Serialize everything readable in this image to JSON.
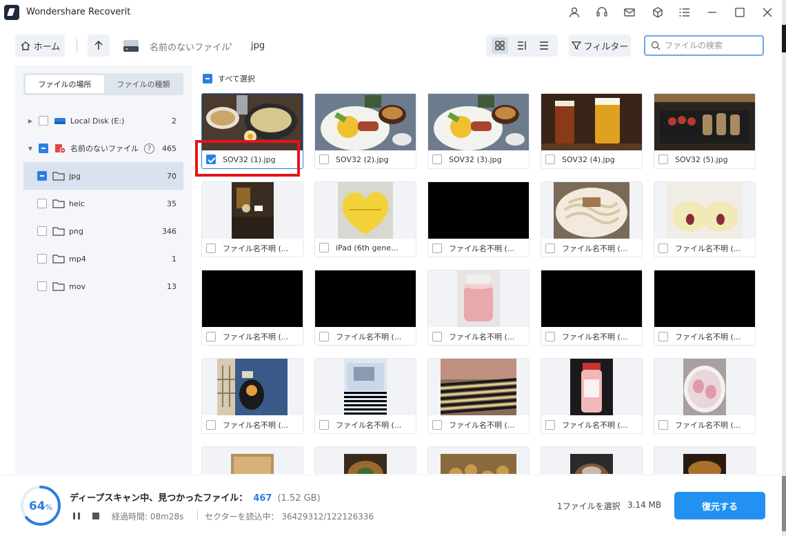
{
  "window": {
    "title": "Wondershare Recoverit"
  },
  "toolbar": {
    "home_label": "ホーム",
    "breadcrumb": [
      "名前のないファイル",
      "jpg"
    ],
    "filter_label": "フィルター",
    "search_placeholder": "ファイルの検索"
  },
  "sidebar": {
    "tabs": [
      "ファイルの場所",
      "ファイルの種類"
    ],
    "active_tab": 0,
    "tree": [
      {
        "label": "Local Disk (E:)",
        "count": "2",
        "level": 0,
        "expanded": false,
        "check": "none"
      },
      {
        "label": "名前のないファイル",
        "count": "465",
        "level": 0,
        "expanded": true,
        "check": "partial"
      },
      {
        "label": "jpg",
        "count": "70",
        "level": 1,
        "selected": true,
        "check": "partial"
      },
      {
        "label": "heic",
        "count": "35",
        "level": 1,
        "check": "none"
      },
      {
        "label": "png",
        "count": "346",
        "level": 1,
        "check": "none"
      },
      {
        "label": "mp4",
        "count": "1",
        "level": 1,
        "check": "none"
      },
      {
        "label": "mov",
        "count": "13",
        "level": 1,
        "check": "none"
      }
    ]
  },
  "grid": {
    "select_all_label": "すべて選択",
    "items": [
      {
        "name": "SOV32 (1).jpg",
        "checked": true,
        "thumb": "noodle-meal"
      },
      {
        "name": "SOV32 (2).jpg",
        "checked": false,
        "thumb": "breakfast-plate"
      },
      {
        "name": "SOV32 (3).jpg",
        "checked": false,
        "thumb": "breakfast-plate"
      },
      {
        "name": "SOV32 (4).jpg",
        "checked": false,
        "thumb": "beer-glasses"
      },
      {
        "name": "SOV32 (5).jpg",
        "checked": false,
        "thumb": "skewers"
      },
      {
        "name": "ファイル名不明 (...",
        "checked": false,
        "thumb": "dark-scene"
      },
      {
        "name": "iPad (6th gene...",
        "checked": false,
        "thumb": "yellow-heart-box"
      },
      {
        "name": "ファイル名不明 (...",
        "checked": false,
        "thumb": "black"
      },
      {
        "name": "ファイル名不明 (...",
        "checked": false,
        "thumb": "udon"
      },
      {
        "name": "ファイル名不明 (...",
        "checked": false,
        "thumb": "peaches"
      },
      {
        "name": "ファイル名不明 (...",
        "checked": false,
        "thumb": "black"
      },
      {
        "name": "ファイル名不明 (...",
        "checked": false,
        "thumb": "black"
      },
      {
        "name": "ファイル名不明 (...",
        "checked": false,
        "thumb": "pink-drink"
      },
      {
        "name": "ファイル名不明 (...",
        "checked": false,
        "thumb": "black"
      },
      {
        "name": "ファイル名不明 (...",
        "checked": false,
        "thumb": "black"
      },
      {
        "name": "ファイル名不明 (...",
        "checked": false,
        "thumb": "plush-window"
      },
      {
        "name": "ファイル名不明 (...",
        "checked": false,
        "thumb": "bag-striped"
      },
      {
        "name": "ファイル名不明 (...",
        "checked": false,
        "thumb": "striped-corrupt"
      },
      {
        "name": "ファイル名不明 (...",
        "checked": false,
        "thumb": "pink-bottle"
      },
      {
        "name": "ファイル名不明 (...",
        "checked": false,
        "thumb": "pink-bowl"
      },
      {
        "name": "",
        "checked": false,
        "thumb": "bread"
      },
      {
        "name": "",
        "checked": false,
        "thumb": "soup-bowl"
      },
      {
        "name": "",
        "checked": false,
        "thumb": "fried-food"
      },
      {
        "name": "",
        "checked": false,
        "thumb": "fried-food-dark"
      },
      {
        "name": "",
        "checked": false,
        "thumb": "curry-corrupt"
      }
    ]
  },
  "status": {
    "progress_value": "64",
    "progress_unit": "%",
    "progress_fraction": 0.64,
    "scan_text": "ディープスキャン中、見つかったファイル：",
    "found_count": "467",
    "found_size": "(1.52 GB)",
    "elapsed": "経過時間: 08m28s",
    "sectors": "セクターを読込中： 36429312/122126336",
    "selection_text": "1ファイルを選択",
    "selection_size": "3.14 MB",
    "recover_label": "復元する"
  },
  "colors": {
    "accent": "#2d7fe0",
    "recover_button": "#2291f2",
    "highlight_box": "#e5141b"
  }
}
